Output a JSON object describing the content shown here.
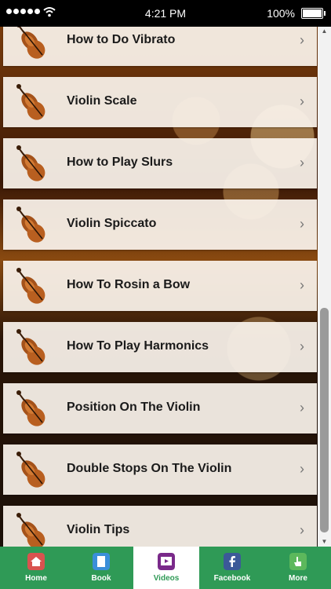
{
  "status_bar": {
    "time": "4:21 PM",
    "battery_percent": "100%"
  },
  "list": {
    "items": [
      {
        "label": "How to Do Vibrato"
      },
      {
        "label": "Violin Scale"
      },
      {
        "label": "How to Play Slurs"
      },
      {
        "label": "Violin Spiccato"
      },
      {
        "label": "How To Rosin a Bow"
      },
      {
        "label": "How To Play Harmonics"
      },
      {
        "label": "Position On The Violin"
      },
      {
        "label": "Double Stops On The Violin"
      },
      {
        "label": "Violin Tips"
      }
    ]
  },
  "tabs": [
    {
      "label": "Home",
      "icon": "home-icon",
      "color": "#d9534f"
    },
    {
      "label": "Book",
      "icon": "book-icon",
      "color": "#3a8fd9"
    },
    {
      "label": "Videos",
      "icon": "videos-icon",
      "color": "#7a2a8a",
      "active": true
    },
    {
      "label": "Facebook",
      "icon": "facebook-icon",
      "color": "#3b5998"
    },
    {
      "label": "More",
      "icon": "more-icon",
      "color": "#5cb85c"
    }
  ],
  "colors": {
    "tabbar_bg": "#2f9a56",
    "row_bg": "#faf3ec"
  }
}
